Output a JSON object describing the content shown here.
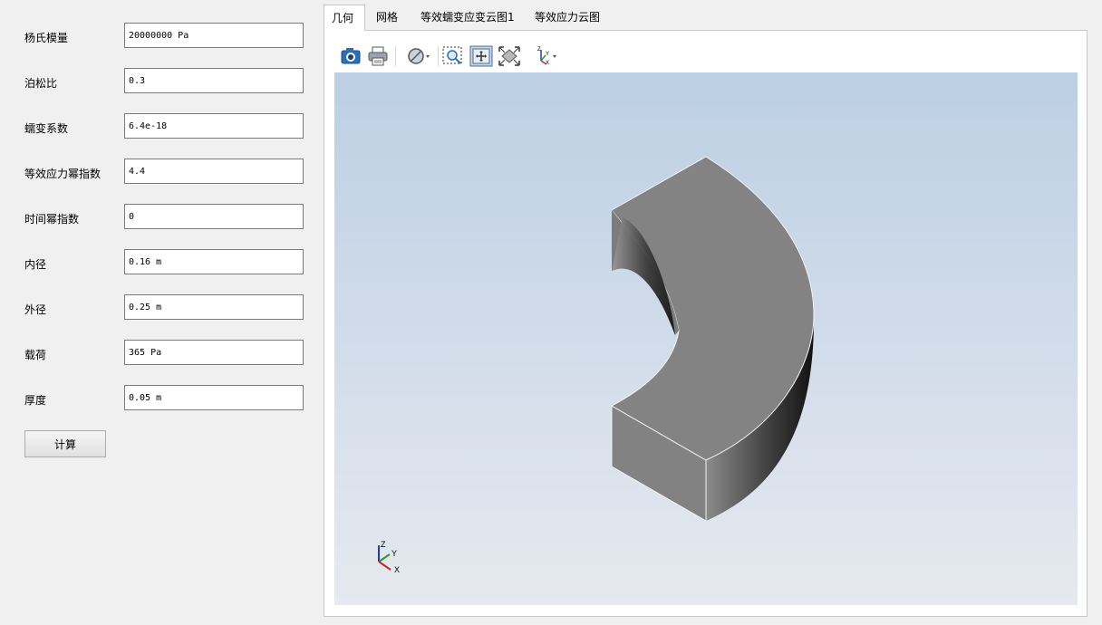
{
  "params": [
    {
      "label": "杨氏模量",
      "value": "20000000 Pa"
    },
    {
      "label": "泊松比",
      "value": "0.3"
    },
    {
      "label": "蠕变系数",
      "value": "6.4e-18"
    },
    {
      "label": "等效应力幂指数",
      "value": "4.4"
    },
    {
      "label": "时间幂指数",
      "value": "0"
    },
    {
      "label": "内径",
      "value": "0.16 m"
    },
    {
      "label": "外径",
      "value": "0.25 m"
    },
    {
      "label": "载荷",
      "value": "365 Pa"
    },
    {
      "label": "厚度",
      "value": "0.05 m"
    }
  ],
  "calculate_label": "计算",
  "tabs": [
    {
      "label": "几何",
      "active": true
    },
    {
      "label": "网格",
      "active": false
    },
    {
      "label": "等效蠕变应变云图1",
      "active": false
    },
    {
      "label": "等效应力云图",
      "active": false
    }
  ],
  "toolbar": {
    "icons": [
      "camera-icon",
      "printer-icon",
      "display-mode-icon",
      "zoom-box-icon",
      "fit-view-icon",
      "zoom-extents-icon",
      "axis-orientation-icon"
    ]
  },
  "triad": {
    "z": "Z",
    "y": "Y",
    "x": "X"
  },
  "colors": {
    "face_top": "#838383",
    "viewport_top": "#bccfe4",
    "viewport_bottom": "#e6e9ef",
    "axis_x": "#c42a2a",
    "axis_y": "#2a9a2a",
    "axis_z": "#1f3fa8"
  }
}
